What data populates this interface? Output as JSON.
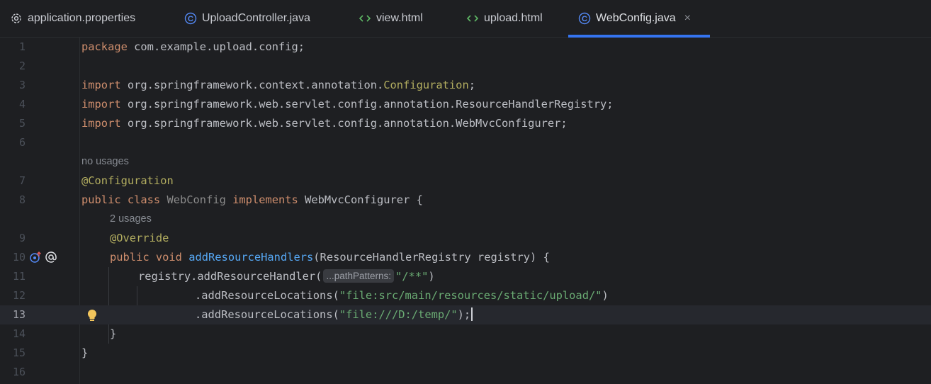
{
  "tabs": [
    {
      "label": "application.properties",
      "icon": "gear-icon"
    },
    {
      "label": "UploadController.java",
      "icon": "java-class-icon"
    },
    {
      "label": "view.html",
      "icon": "html-icon"
    },
    {
      "label": "upload.html",
      "icon": "html-icon"
    },
    {
      "label": "WebConfig.java",
      "icon": "java-class-icon",
      "active": true
    }
  ],
  "close_glyph": "×",
  "colors": {
    "accent": "#3574f0",
    "keyword": "#cf8e6d",
    "annotation": "#b3ae60",
    "string": "#6aab73",
    "function": "#56a8f5"
  },
  "code": {
    "l1": {
      "num": "1",
      "kw": "package",
      "rest": " com.example.upload.config;"
    },
    "l2": {
      "num": "2"
    },
    "l3": {
      "num": "3",
      "kw": "import",
      "rest": " org.springframework.context.annotation.",
      "ann": "Configuration",
      "end": ";"
    },
    "l4": {
      "num": "4",
      "kw": "import",
      "rest": " org.springframework.web.servlet.config.annotation.ResourceHandlerRegistry;"
    },
    "l5": {
      "num": "5",
      "kw": "import",
      "rest": " org.springframework.web.servlet.config.annotation.WebMvcConfigurer;"
    },
    "l6": {
      "num": "6"
    },
    "usages1": "no usages",
    "l7": {
      "num": "7",
      "ann": "@Configuration"
    },
    "l8": {
      "num": "8",
      "kw1": "public class",
      "cls": " WebConfig ",
      "kw2": "implements",
      "rest": " WebMvcConfigurer {"
    },
    "usages2": "2 usages",
    "l9": {
      "num": "9",
      "ann": "@Override"
    },
    "l10": {
      "num": "10",
      "kw": "public void",
      "fn": "addResourceHandlers",
      "rest": "(ResourceHandlerRegistry registry) {"
    },
    "l11": {
      "num": "11",
      "pre": "registry.addResourceHandler(",
      "hint": "...pathPatterns:",
      "str": "\"/**\"",
      "end": ")"
    },
    "l12": {
      "num": "12",
      "pre": ".addResourceLocations(",
      "str": "\"file:src/main/resources/static/upload/\"",
      "end": ")"
    },
    "l13": {
      "num": "13",
      "pre": ".addResourceLocations(",
      "str": "\"file:///D:/temp/\"",
      "end": ");"
    },
    "l14": {
      "num": "14",
      "text": "}"
    },
    "l15": {
      "num": "15",
      "text": "}"
    },
    "l16": {
      "num": "16"
    }
  }
}
